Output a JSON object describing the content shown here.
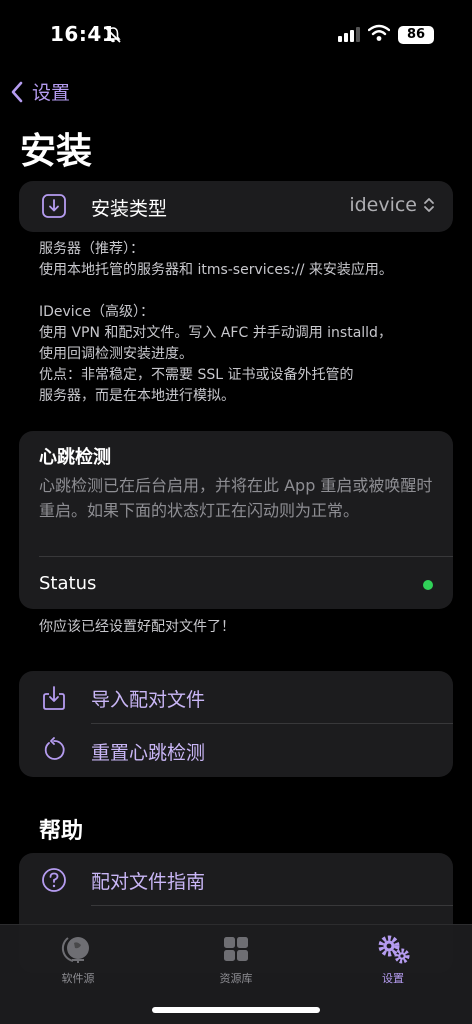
{
  "status_bar": {
    "time": "16:41",
    "battery": "86"
  },
  "nav": {
    "back_label": "设置",
    "title": "安装"
  },
  "install_type": {
    "label": "安装类型",
    "value": "idevice"
  },
  "install_footnote": "服务器（推荐）：\n使用本地托管的服务器和 itms-services:// 来安装应用。\n\nIDevice（高级）：\n使用 VPN 和配对文件。写入 AFC 并手动调用 installd，\n使用回调检测安装进度。\n优点：非常稳定，不需要 SSL 证书或设备外托管的\n服务器，而是在本地进行模拟。",
  "heartbeat": {
    "title": "心跳检测",
    "description": "心跳检测已在后台启用，并将在此 App 重启或被唤醒时重启。如果下面的状态灯正在闪动则为正常。",
    "status_label": "Status",
    "status_color": "#30d158"
  },
  "pairing_note": "你应该已经设置好配对文件了！",
  "actions": {
    "import_label": "导入配对文件",
    "reset_label": "重置心跳检测"
  },
  "help": {
    "header": "帮助",
    "guide_label": "配对文件指南"
  },
  "tabs": [
    {
      "label": "软件源",
      "icon": "globe-icon",
      "active": false
    },
    {
      "label": "资源库",
      "icon": "grid-icon",
      "active": false
    },
    {
      "label": "设置",
      "icon": "gears-icon",
      "active": true
    }
  ],
  "colors": {
    "accent": "#b59cf0",
    "background": "#000000",
    "card": "#1c1c1e"
  }
}
